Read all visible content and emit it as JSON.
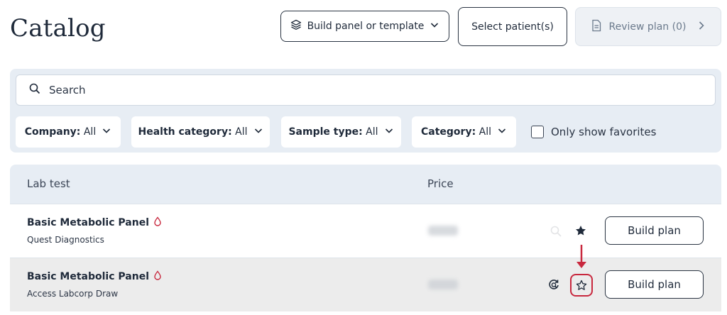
{
  "page": {
    "title": "Catalog"
  },
  "header": {
    "build_panel_label": "Build panel or template",
    "select_patients_label": "Select patient(s)",
    "review_plan_label": "Review plan (0)"
  },
  "filters": {
    "search_placeholder": "Search",
    "company": {
      "label": "Company:",
      "value": "All"
    },
    "health_category": {
      "label": "Health category:",
      "value": "All"
    },
    "sample_type": {
      "label": "Sample type:",
      "value": "All"
    },
    "category": {
      "label": "Category:",
      "value": "All"
    },
    "favorites_label": "Only show favorites"
  },
  "table": {
    "columns": {
      "lab_test": "Lab test",
      "price": "Price"
    },
    "rows": [
      {
        "name": "Basic Metabolic Panel",
        "company": "Quest Diagnostics",
        "favorited": true,
        "action_label": "Build plan"
      },
      {
        "name": "Basic Metabolic Panel",
        "company": "Access Labcorp Draw",
        "favorited": false,
        "action_label": "Build plan"
      }
    ]
  },
  "colors": {
    "highlight": "#c8283e",
    "panel_bg": "#e7edf4",
    "text": "#1f2a3a"
  },
  "icons": [
    "layers-icon",
    "chevron-down-icon",
    "document-icon",
    "chevron-right-icon",
    "search-icon",
    "blood-drop-icon",
    "star-icon",
    "star-outline-icon",
    "refresh-search-icon",
    "annotation-arrow"
  ]
}
